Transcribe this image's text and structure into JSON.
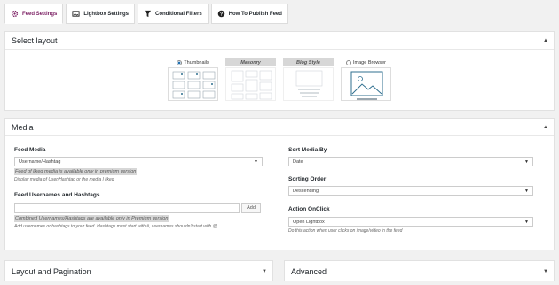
{
  "tabs": [
    {
      "label": "Feed Settings",
      "icon": "gear-icon"
    },
    {
      "label": "Lightbox Settings",
      "icon": "image-icon"
    },
    {
      "label": "Conditional Filters",
      "icon": "filter-icon"
    },
    {
      "label": "How To Publish Feed",
      "icon": "question-icon"
    }
  ],
  "layout_panel": {
    "title": "Select layout",
    "options": [
      {
        "label": "Thumbnails",
        "selected": true
      },
      {
        "label": "Masonry",
        "pro": true
      },
      {
        "label": "Blog Style",
        "pro": true
      },
      {
        "label": "Image Browser",
        "selected": false
      }
    ]
  },
  "media_panel": {
    "title": "Media",
    "feed_media": {
      "label": "Feed Media",
      "value": "Username/Hashtag",
      "pro_note": "Feed of liked media is available only in premium version",
      "hint": "Display media of User/Hashtag or the media I liked"
    },
    "usernames": {
      "label": "Feed Usernames and Hashtags",
      "add_label": "Add",
      "pro_note": "Combined Usernames/Hashtags are available only in Premium version",
      "hint": "Add usernames or hashtags to your feed. Hashtags must start with #, usernames shouldn't start with @."
    },
    "sort_by": {
      "label": "Sort Media By",
      "value": "Date"
    },
    "sort_order": {
      "label": "Sorting Order",
      "value": "Descending"
    },
    "action": {
      "label": "Action OnClick",
      "value": "Open Lightbox",
      "hint": "Do this action when user clicks on image/video in the feed"
    }
  },
  "pagination_panel": {
    "title": "Layout and Pagination"
  },
  "advanced_panel": {
    "title": "Advanced"
  },
  "colors": {
    "accent": "#7b1f63",
    "panel_bg": "#ffffff",
    "page_bg": "#f1f1f1"
  }
}
